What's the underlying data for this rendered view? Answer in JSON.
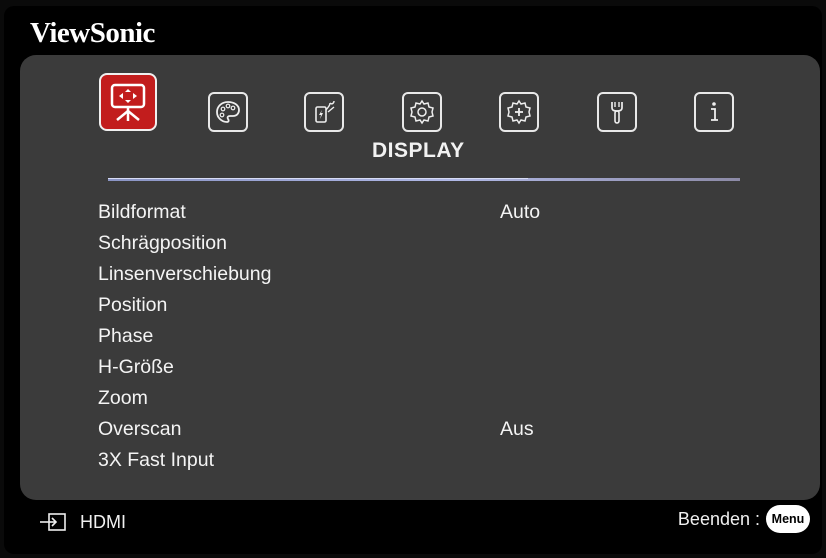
{
  "brand": "ViewSonic",
  "section_title": "DISPLAY",
  "tabs": [
    {
      "id": "display",
      "icon": "display-icon",
      "active": true
    },
    {
      "id": "image",
      "icon": "palette-icon"
    },
    {
      "id": "power",
      "icon": "power-management-icon"
    },
    {
      "id": "basic",
      "icon": "gear-basic-icon"
    },
    {
      "id": "advanced",
      "icon": "gear-advanced-icon"
    },
    {
      "id": "system",
      "icon": "wrench-icon"
    },
    {
      "id": "info",
      "icon": "info-icon"
    }
  ],
  "menu_items": [
    {
      "label": "Bildformat",
      "value": "Auto"
    },
    {
      "label": "Schrägposition",
      "value": ""
    },
    {
      "label": "Linsenverschiebung",
      "value": ""
    },
    {
      "label": "Position",
      "value": ""
    },
    {
      "label": "Phase",
      "value": ""
    },
    {
      "label": "H-Größe",
      "value": ""
    },
    {
      "label": "Zoom",
      "value": ""
    },
    {
      "label": "Overscan",
      "value": "Aus"
    },
    {
      "label": "3X Fast Input",
      "value": ""
    }
  ],
  "footer": {
    "source_label": "HDMI",
    "exit_label": "Beenden :",
    "menu_key": "Menu"
  }
}
